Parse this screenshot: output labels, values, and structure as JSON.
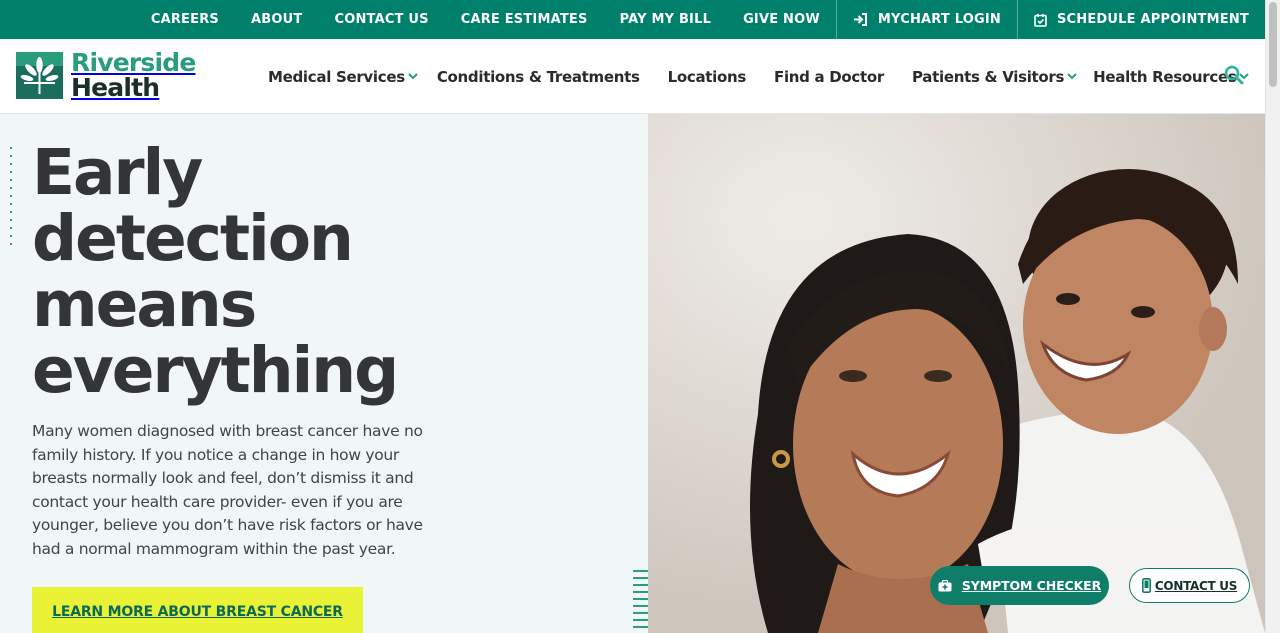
{
  "colors": {
    "brand_green": "#00806b",
    "accent_teal": "#2a9d7c",
    "cta_yellow": "#eaf235",
    "hero_bg": "#f1f6f6"
  },
  "topbar": {
    "links": [
      "CAREERS",
      "ABOUT",
      "CONTACT US",
      "CARE ESTIMATES",
      "PAY MY BILL",
      "GIVE NOW"
    ],
    "mychart_label": "MYCHART LOGIN",
    "mychart_icon": "sign-in-icon",
    "schedule_label": "SCHEDULE APPOINTMENT",
    "schedule_icon": "calendar-check-icon"
  },
  "logo": {
    "line1": "Riverside",
    "line2": "Health"
  },
  "nav": {
    "items": [
      {
        "label": "Medical Services",
        "dropdown": true
      },
      {
        "label": "Conditions & Treatments",
        "dropdown": false
      },
      {
        "label": "Locations",
        "dropdown": false
      },
      {
        "label": "Find a Doctor",
        "dropdown": false
      },
      {
        "label": "Patients & Visitors",
        "dropdown": true
      },
      {
        "label": "Health Resources",
        "dropdown": true
      }
    ],
    "search_icon": "search-icon"
  },
  "hero": {
    "headline_lines": [
      "Early",
      "detection",
      "means",
      "everything"
    ],
    "body": "Many women diagnosed with breast cancer have no family history. If you notice a change in how your breasts normally look and feel, don’t dismiss it and contact your health care provider- even if you are younger, believe you don’t have risk factors or have had a normal mammogram within the past year.",
    "cta_label": "LEARN MORE ABOUT BREAST CANCER"
  },
  "floating": {
    "symptom_label": "SYMPTOM CHECKER",
    "symptom_icon": "medical-kit-icon",
    "contact_label": "CONTACT US",
    "contact_icon": "mobile-phone-icon"
  }
}
